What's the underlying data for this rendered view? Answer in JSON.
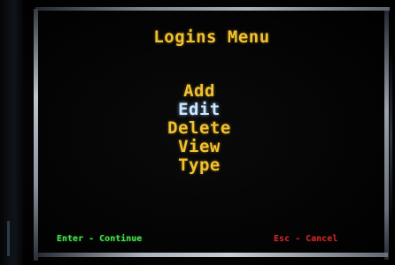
{
  "screen": {
    "title": "Logins Menu",
    "menu_items": [
      {
        "label": "Add",
        "selected": false
      },
      {
        "label": "Edit",
        "selected": true
      },
      {
        "label": "Delete",
        "selected": false
      },
      {
        "label": "View",
        "selected": false
      },
      {
        "label": "Type",
        "selected": false
      }
    ],
    "footer": {
      "continue_hint": "Enter - Continue",
      "cancel_hint": "Esc - Cancel"
    }
  },
  "colors": {
    "background": "#000000",
    "menu_text": "#f2c12e",
    "selected_text": "#cfe8ff",
    "continue_hint": "#46e04c",
    "cancel_hint": "#c2262a"
  }
}
